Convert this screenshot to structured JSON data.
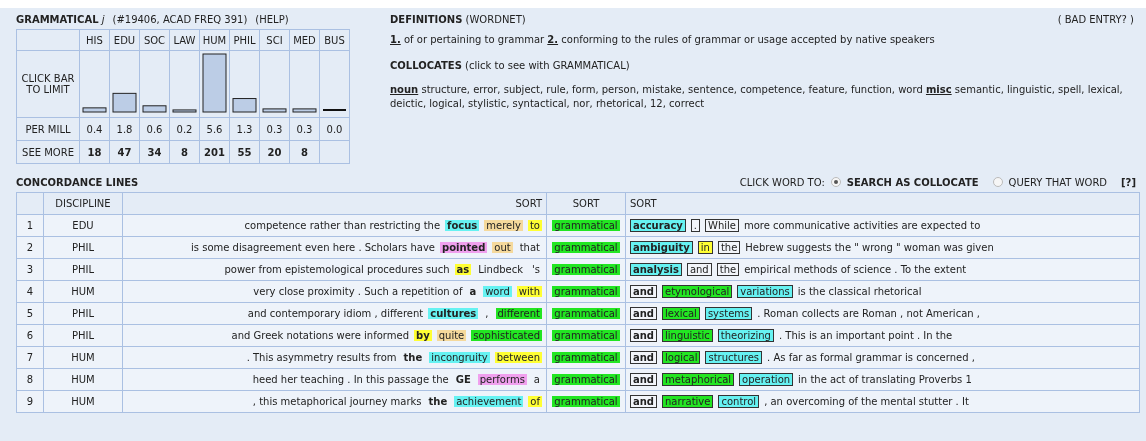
{
  "entry": {
    "word": "GRAMMATICAL",
    "pos": "j",
    "info": "(#19406, ACAD FREQ 391)",
    "help": "(HELP)"
  },
  "frequency": {
    "bar_label": "CLICK BAR TO LIMIT",
    "per_mill_label": "PER MILL",
    "see_more_label": "SEE MORE",
    "see_more": [
      "18",
      "47",
      "34",
      "8",
      "201",
      "55",
      "20",
      "8"
    ],
    "chart_data": {
      "type": "bar",
      "categories": [
        "HIS",
        "EDU",
        "SOC",
        "LAW",
        "HUM",
        "PHIL",
        "SCI",
        "MED",
        "BUS"
      ],
      "values": [
        0.4,
        1.8,
        0.6,
        0.2,
        5.6,
        1.3,
        0.3,
        0.3,
        0.0
      ],
      "value_labels": [
        "0.4",
        "1.8",
        "0.6",
        "0.2",
        "5.6",
        "1.3",
        "0.3",
        "0.3",
        "0.0"
      ]
    }
  },
  "definitions": {
    "title": "DEFINITIONS",
    "source": "(WORDNET)",
    "bad_entry": "( BAD ENTRY? )",
    "items": [
      {
        "num": "1.",
        "text": "of or pertaining to grammar"
      },
      {
        "num": "2.",
        "text": "conforming to the rules of grammar or usage accepted by native speakers"
      }
    ]
  },
  "collocates": {
    "title": "COLLOCATES",
    "hint": "(click to see with GRAMMATICAL)",
    "groups": [
      {
        "pos": "noun",
        "words": "structure, error, subject, rule, form, person, mistake, sentence, competence, feature, function, word"
      },
      {
        "pos": "misc",
        "words": "semantic, linguistic, spell, lexical, deictic, logical, stylistic, syntactical, nor, rhetorical, 12, correct"
      }
    ]
  },
  "concordance": {
    "title": "CONCORDANCE LINES",
    "click_label": "CLICK WORD TO:",
    "options": [
      {
        "label": "SEARCH AS COLLOCATE",
        "selected": true
      },
      {
        "label": "QUERY THAT WORD",
        "selected": false
      }
    ],
    "help": "[?]",
    "columns": [
      "DISCIPLINE",
      "SORT",
      "SORT",
      "SORT"
    ],
    "rows": [
      {
        "num": "1",
        "discipline": "EDU",
        "left_text": "competence rather than restricting the",
        "left_tokens": [
          {
            "text": "focus",
            "color": "#66f2f2",
            "bold": true
          },
          {
            "text": "merely",
            "color": "#f5d99c",
            "bold": false
          },
          {
            "text": "to",
            "color": "#ffff33",
            "bold": false
          }
        ],
        "node": {
          "text": "grammatical",
          "color": "#22e622"
        },
        "right_tokens": [
          {
            "text": "accuracy",
            "color": "#66f2f2",
            "bold": true
          },
          {
            "text": ".",
            "bold": false
          },
          {
            "text": "While",
            "bold": false
          }
        ],
        "right_text": "more communicative activities are expected to"
      },
      {
        "num": "2",
        "discipline": "PHIL",
        "left_text": "is some disagreement even here . Scholars have",
        "left_tokens": [
          {
            "text": "pointed",
            "color": "#f0a0ee",
            "bold": true
          },
          {
            "text": "out",
            "color": "#f5d99c",
            "bold": false
          },
          {
            "text": "that",
            "bold": false
          }
        ],
        "node": {
          "text": "grammatical",
          "color": "#22e622"
        },
        "right_tokens": [
          {
            "text": "ambiguity",
            "color": "#66f2f2",
            "bold": true
          },
          {
            "text": "in",
            "color": "#ffff33",
            "bold": false
          },
          {
            "text": "the",
            "bold": false
          }
        ],
        "right_text": "Hebrew suggests the \" wrong \" woman was given"
      },
      {
        "num": "3",
        "discipline": "PHIL",
        "left_text": "power from epistemological procedures such",
        "left_tokens": [
          {
            "text": "as",
            "color": "#ffff33",
            "bold": true
          },
          {
            "text": "Lindbeck",
            "bold": false
          },
          {
            "text": "'s",
            "bold": false
          }
        ],
        "node": {
          "text": "grammatical",
          "color": "#22e622"
        },
        "right_tokens": [
          {
            "text": "analysis",
            "color": "#66f2f2",
            "bold": true
          },
          {
            "text": "and",
            "bold": false
          },
          {
            "text": "the",
            "bold": false
          }
        ],
        "right_text": "empirical methods of science . To the extent"
      },
      {
        "num": "4",
        "discipline": "HUM",
        "left_text": "very close proximity . Such a repetition of",
        "left_tokens": [
          {
            "text": "a",
            "bold": true
          },
          {
            "text": "word",
            "color": "#66f2f2",
            "bold": false
          },
          {
            "text": "with",
            "color": "#ffff33",
            "bold": false
          }
        ],
        "node": {
          "text": "grammatical",
          "color": "#22e622"
        },
        "right_tokens": [
          {
            "text": "and",
            "bold": true
          },
          {
            "text": "etymological",
            "color": "#22e622",
            "bold": false
          },
          {
            "text": "variations",
            "color": "#66f2f2",
            "bold": false
          }
        ],
        "right_text": "is the classical rhetorical"
      },
      {
        "num": "5",
        "discipline": "PHIL",
        "left_text": "and contemporary idiom , different",
        "left_tokens": [
          {
            "text": "cultures",
            "color": "#66f2f2",
            "bold": true
          },
          {
            "text": ",",
            "bold": false
          },
          {
            "text": "different",
            "color": "#22e622",
            "bold": false
          }
        ],
        "node": {
          "text": "grammatical",
          "color": "#22e622"
        },
        "right_tokens": [
          {
            "text": "and",
            "bold": true
          },
          {
            "text": "lexical",
            "color": "#22e622",
            "bold": false
          },
          {
            "text": "systems",
            "color": "#66f2f2",
            "bold": false
          }
        ],
        "right_text": ". Roman collects are Roman , not American ,"
      },
      {
        "num": "6",
        "discipline": "PHIL",
        "left_text": "and Greek notations were informed",
        "left_tokens": [
          {
            "text": "by",
            "color": "#ffff33",
            "bold": true
          },
          {
            "text": "quite",
            "color": "#f5d99c",
            "bold": false
          },
          {
            "text": "sophisticated",
            "color": "#22e622",
            "bold": false
          }
        ],
        "node": {
          "text": "grammatical",
          "color": "#22e622"
        },
        "right_tokens": [
          {
            "text": "and",
            "bold": true
          },
          {
            "text": "linguistic",
            "color": "#22e622",
            "bold": false
          },
          {
            "text": "theorizing",
            "color": "#66f2f2",
            "bold": false
          }
        ],
        "right_text": ". This is an important point . In the"
      },
      {
        "num": "7",
        "discipline": "HUM",
        "left_text": ". This asymmetry results from",
        "left_tokens": [
          {
            "text": "the",
            "bold": true
          },
          {
            "text": "incongruity",
            "color": "#66f2f2",
            "bold": false
          },
          {
            "text": "between",
            "color": "#ffff33",
            "bold": false
          }
        ],
        "node": {
          "text": "grammatical",
          "color": "#22e622"
        },
        "right_tokens": [
          {
            "text": "and",
            "bold": true
          },
          {
            "text": "logical",
            "color": "#22e622",
            "bold": false
          },
          {
            "text": "structures",
            "color": "#66f2f2",
            "bold": false
          }
        ],
        "right_text": ". As far as formal grammar is concerned ,"
      },
      {
        "num": "8",
        "discipline": "HUM",
        "left_text": "heed her teaching . In this passage the",
        "left_tokens": [
          {
            "text": "GE",
            "bold": true
          },
          {
            "text": "performs",
            "color": "#f0a0ee",
            "bold": false
          },
          {
            "text": "a",
            "bold": false
          }
        ],
        "node": {
          "text": "grammatical",
          "color": "#22e622"
        },
        "right_tokens": [
          {
            "text": "and",
            "bold": true
          },
          {
            "text": "metaphorical",
            "color": "#22e622",
            "bold": false
          },
          {
            "text": "operation",
            "color": "#66f2f2",
            "bold": false
          }
        ],
        "right_text": "in the act of translating Proverbs 1"
      },
      {
        "num": "9",
        "discipline": "HUM",
        "left_text": ", this metaphorical journey marks",
        "left_tokens": [
          {
            "text": "the",
            "bold": true
          },
          {
            "text": "achievement",
            "color": "#66f2f2",
            "bold": false
          },
          {
            "text": "of",
            "color": "#ffff33",
            "bold": false
          }
        ],
        "node": {
          "text": "grammatical",
          "color": "#22e622"
        },
        "right_tokens": [
          {
            "text": "and",
            "bold": true
          },
          {
            "text": "narrative",
            "color": "#22e622",
            "bold": false
          },
          {
            "text": "control",
            "color": "#66f2f2",
            "bold": false
          }
        ],
        "right_text": ", an overcoming of the mental stutter . It"
      }
    ]
  }
}
